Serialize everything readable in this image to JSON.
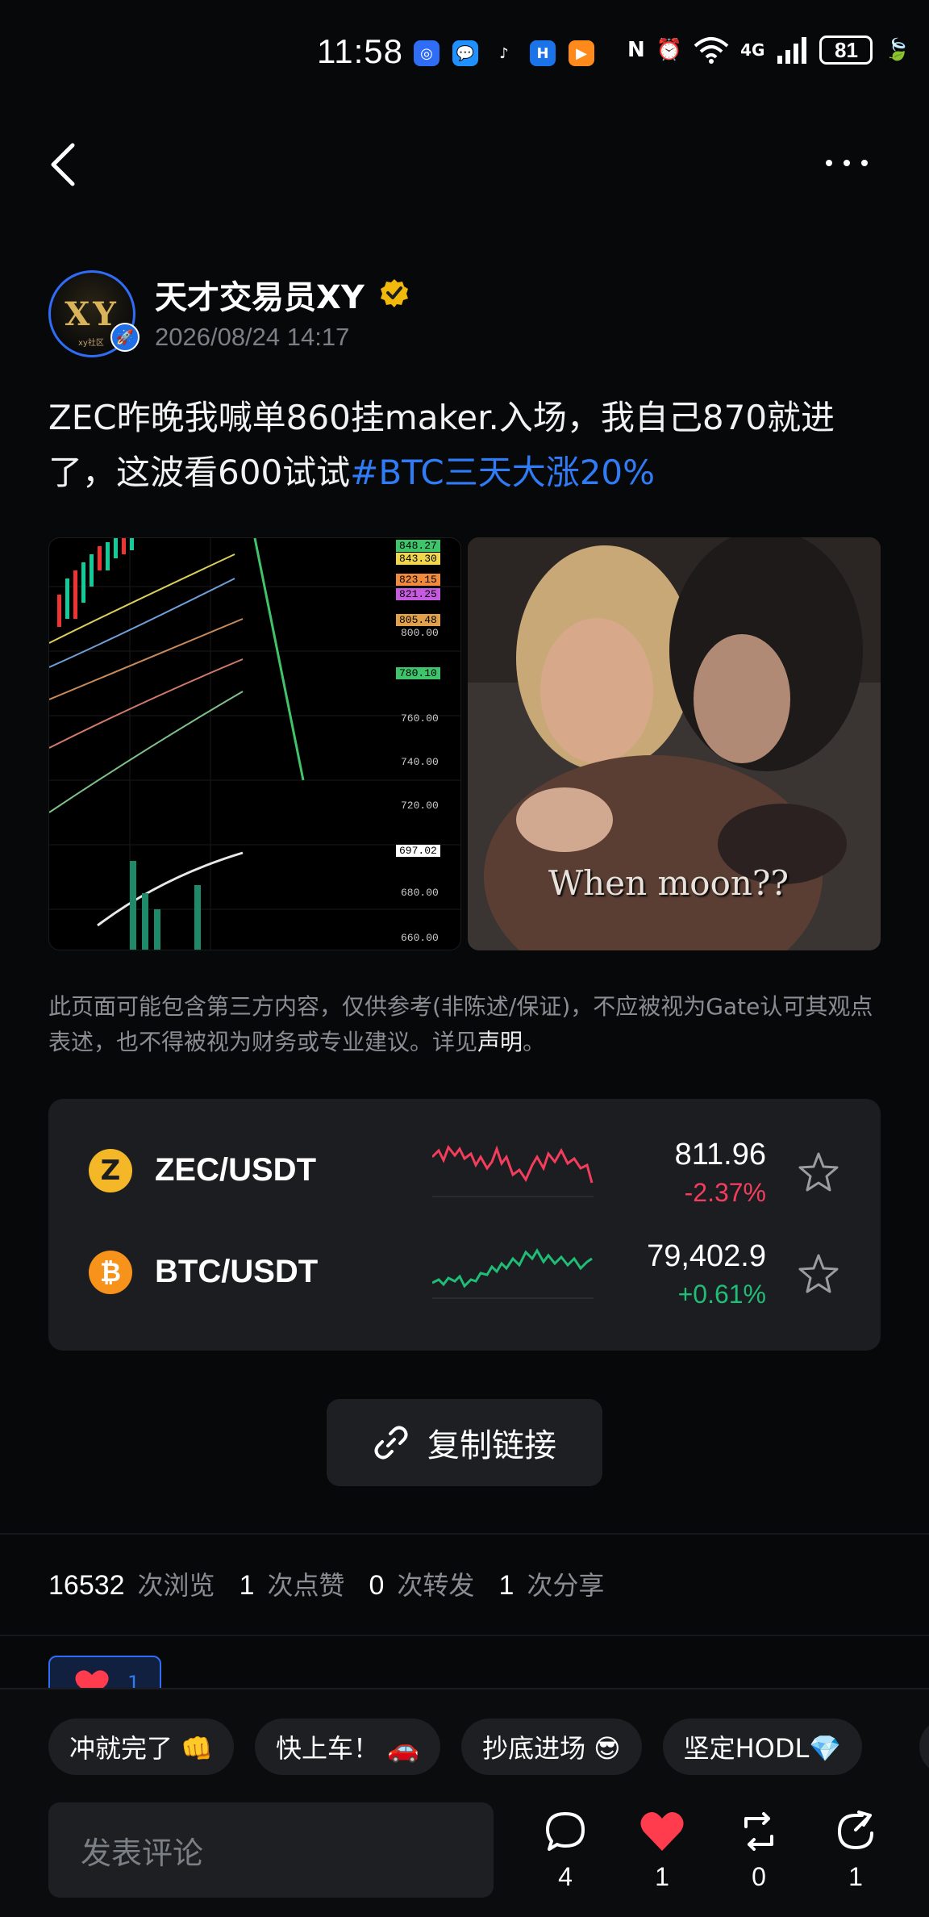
{
  "status_bar": {
    "time": "11:58",
    "battery": "81",
    "network": "4G",
    "wifi_label": "6"
  },
  "post": {
    "author": "天才交易员XY",
    "avatar_text": "XY",
    "avatar_sub": "xy社区",
    "timestamp": "2026/08/24 14:17",
    "text_main": "ZEC昨晚我喊单860挂maker.入场，我自己870就进了，这波看600试试",
    "hashtag": "#BTC三天大涨20%",
    "gif_caption": "When moon??",
    "chart_labels": [
      "848.27",
      "843.30",
      "823.15",
      "821.25",
      "805.48",
      "800.00",
      "780.10",
      "760.00",
      "740.00",
      "720.00",
      "697.02",
      "680.00",
      "660.00"
    ]
  },
  "disclaimer": {
    "text": "此页面可能包含第三方内容，仅供参考(非陈述/保证)，不应被视为Gate认可其观点表述，也不得被视为财务或专业建议。详见",
    "link": "声明",
    "end": "。"
  },
  "market": [
    {
      "pair": "ZEC/USDT",
      "symbol": "Z",
      "icon_color": "#f4b728",
      "price": "811.96",
      "change": "-2.37%",
      "direction": "down"
    },
    {
      "pair": "BTC/USDT",
      "symbol": "₿",
      "icon_color": "#f7931a",
      "price": "79,402.9",
      "change": "+0.61%",
      "direction": "up"
    }
  ],
  "copy_link": {
    "label": "复制链接"
  },
  "stats": {
    "views": "16532",
    "views_label": "次浏览",
    "likes": "1",
    "likes_label": "次点赞",
    "reposts": "0",
    "reposts_label": "次转发",
    "shares": "1",
    "shares_label": "次分享"
  },
  "reaction": {
    "count": "1"
  },
  "quick_replies": [
    "冲就完了 👊",
    "快上车！ 🚗",
    "抄底进场 😎",
    "坚定HODL💎"
  ],
  "comment": {
    "placeholder": "发表评论"
  },
  "actions": {
    "comments": "4",
    "likes": "1",
    "reposts": "0",
    "shares": "1"
  },
  "colors": {
    "accent": "#2f7cf6",
    "down": "#f23d5d",
    "up": "#1fbd76",
    "like": "#ff3c4d"
  }
}
